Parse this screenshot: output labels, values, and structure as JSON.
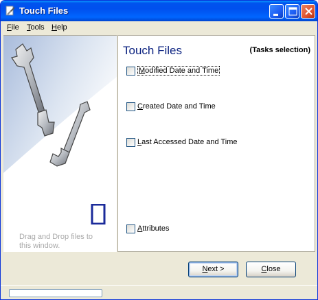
{
  "window": {
    "title": "Touch Files"
  },
  "menu": {
    "file_pre": "",
    "file_ul": "F",
    "file_post": "ile",
    "tools_pre": "",
    "tools_ul": "T",
    "tools_post": "ools",
    "help_pre": "",
    "help_ul": "H",
    "help_post": "elp"
  },
  "left": {
    "counter": "0",
    "drag_text": "Drag and Drop files to this window."
  },
  "right": {
    "title": "Touch Files",
    "subtitle": "(Tasks selection)",
    "options": [
      {
        "pre": "",
        "ul": "M",
        "post": "odified Date and Time",
        "checked": false
      },
      {
        "pre": "",
        "ul": "C",
        "post": "reated Date and Time",
        "checked": false
      },
      {
        "pre": "",
        "ul": "L",
        "post": "ast Accessed Date and Time",
        "checked": false
      },
      {
        "pre": "",
        "ul": "A",
        "post": "ttributes",
        "checked": false
      }
    ]
  },
  "buttons": {
    "next_ul": "N",
    "next_post": "ext >",
    "close_ul": "C",
    "close_post": "lose"
  },
  "status": {
    "progress": 0
  },
  "icons": {
    "app": "touch-files-app-icon",
    "wrench": "wrench-icon"
  },
  "colors": {
    "title_blue": "#0b2280",
    "counter": "#1a2a9a"
  }
}
